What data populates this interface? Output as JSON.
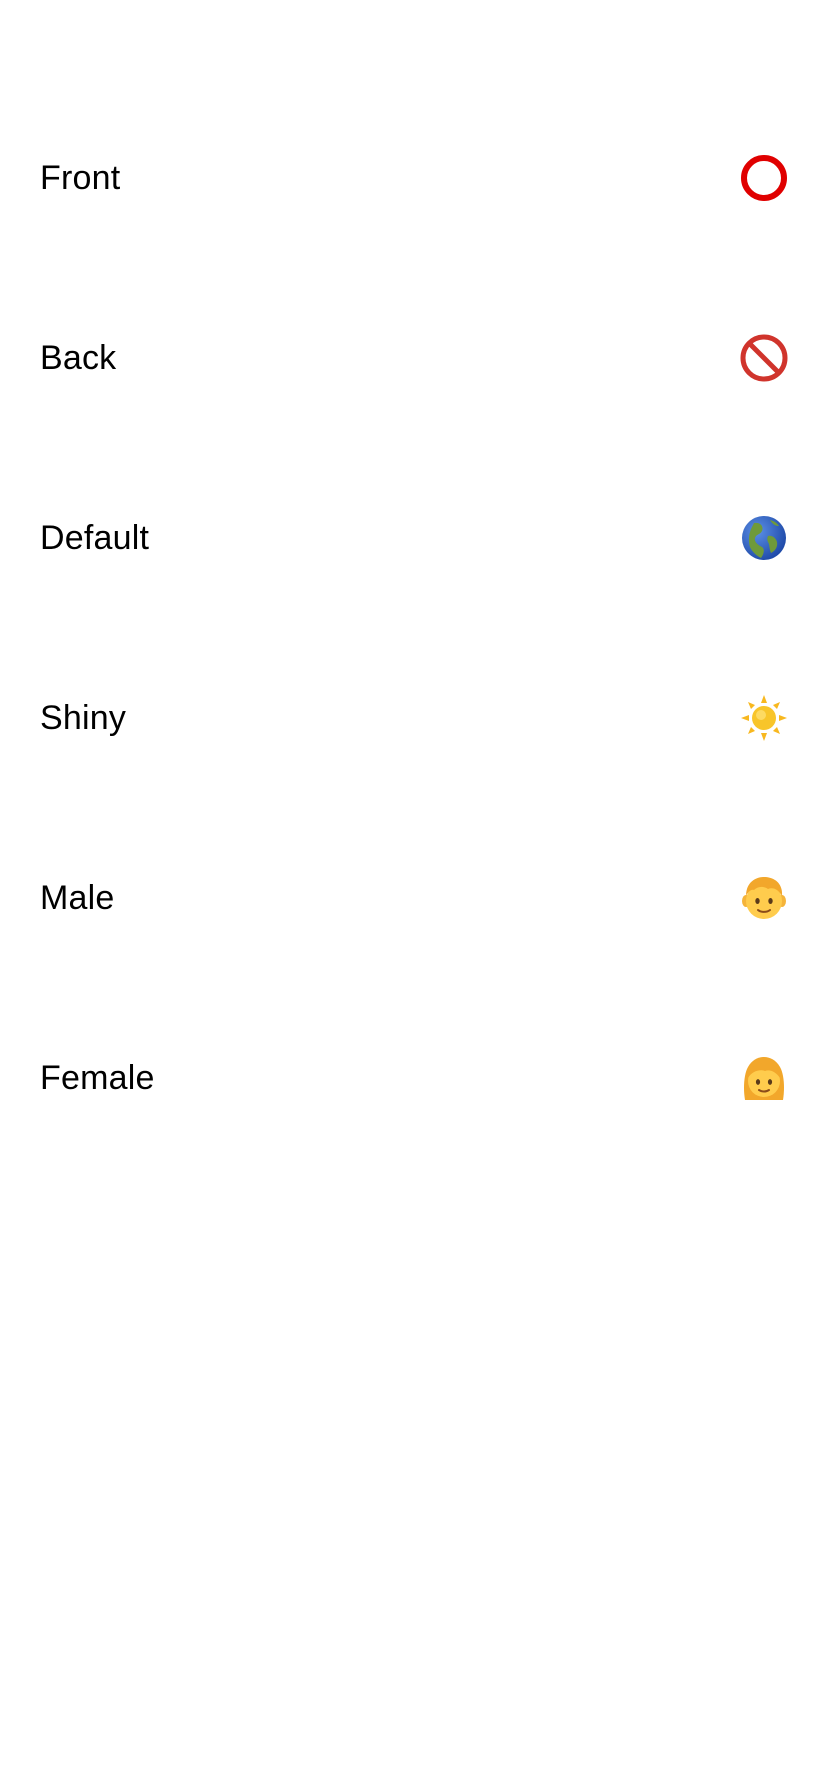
{
  "options": [
    {
      "label": "Front",
      "icon": "heavy-large-circle-icon"
    },
    {
      "label": "Back",
      "icon": "prohibited-icon"
    },
    {
      "label": "Default",
      "icon": "globe-americas-icon"
    },
    {
      "label": "Shiny",
      "icon": "sun-icon"
    },
    {
      "label": "Male",
      "icon": "boy-icon"
    },
    {
      "label": "Female",
      "icon": "woman-icon"
    }
  ],
  "colors": {
    "background": "#ffffff",
    "text": "#000000",
    "circle_red": "#e00000",
    "prohibited_red": "#d0342c",
    "globe_blue": "#2f5fc4",
    "globe_green": "#6f9a3a",
    "sun_yellow": "#f8c52a",
    "face_skin": "#ffcc4d",
    "hair_blonde": "#f2a72b"
  }
}
